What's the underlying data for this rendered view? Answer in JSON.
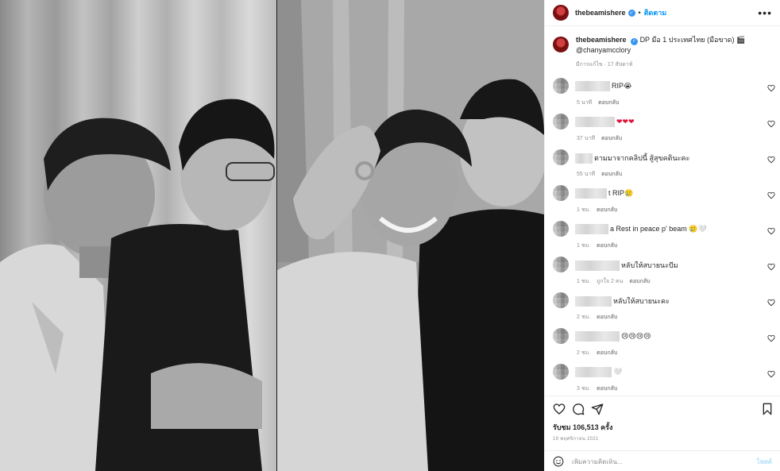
{
  "header": {
    "username": "thebeamishere",
    "follow_label": "ติดตาม",
    "more_label": "•••"
  },
  "caption": {
    "username": "thebeamishere",
    "text": "DP มือ 1 ประเทศไทย (มือขาด) 🎬",
    "mention": "@chanyamcclory",
    "meta": "มีการแก้ไข · 17 สัปดาห์"
  },
  "comments": [
    {
      "text": "RIP😭",
      "time": "5 นาที",
      "likes": "",
      "reply": "ตอบกลับ"
    },
    {
      "text": "❤❤❤",
      "time": "37 นาที",
      "likes": "",
      "reply": "ตอบกลับ"
    },
    {
      "text": "ตามมาจากคลิปนี้ สู้สุขคตินะคะ",
      "time": "55 นาที",
      "likes": "",
      "reply": "ตอบกลับ"
    },
    {
      "text": "t RIP🥲",
      "time": "1 ชม.",
      "likes": "",
      "reply": "ตอบกลับ"
    },
    {
      "text": "a Rest in peace p' beam 🥲🤍",
      "time": "1 ชม.",
      "likes": "",
      "reply": "ตอบกลับ"
    },
    {
      "text": "หลับให้สบายนะบีม",
      "time": "1 ชม.",
      "likes": "ถูกใจ 2 คน",
      "reply": "ตอบกลับ"
    },
    {
      "text": "หลับให้สบายนะคะ",
      "time": "2 ชม.",
      "likes": "",
      "reply": "ตอบกลับ"
    },
    {
      "text": "😢😢😢😢",
      "time": "2 ชม.",
      "likes": "",
      "reply": "ตอบกลับ"
    },
    {
      "text": "🤍",
      "time": "3 ชม.",
      "likes": "",
      "reply": "ตอบกลับ"
    }
  ],
  "footer": {
    "views": "รับชม 106,513 ครั้ง",
    "date": "19 พฤศจิกายน 2021",
    "comment_placeholder": "เพิ่มความคิดเห็น...",
    "post_label": "โพสต์"
  },
  "colors": {
    "accent": "#0095f6",
    "verified": "#3897f0",
    "muted": "#8e8e8e"
  }
}
